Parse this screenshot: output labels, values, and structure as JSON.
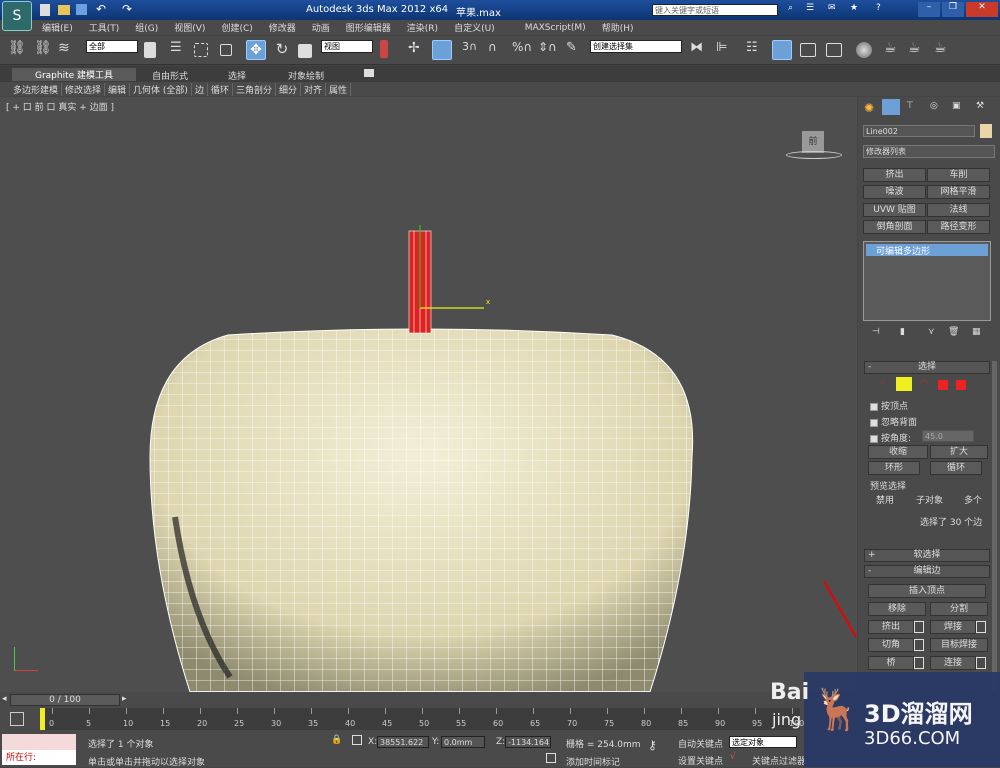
{
  "title": {
    "app": "Autodesk 3ds Max  2012 x64",
    "file": "苹果.max",
    "search_placeholder": "键入关键字或短语"
  },
  "menu": [
    "编辑(E)",
    "工具(T)",
    "组(G)",
    "视图(V)",
    "创建(C)",
    "修改器",
    "动画",
    "图形编辑器",
    "渲染(R)",
    "自定义(U)",
    "MAXScript(M)",
    "帮助(H)"
  ],
  "toolbar": {
    "select_filter": "全部",
    "ref_coord": "视图",
    "named_sel": "创建选择集"
  },
  "ribbon": {
    "tabs": [
      "Graphite 建模工具",
      "自由形式",
      "选择",
      "对象绘制"
    ],
    "items": [
      "多边形建模",
      "修改选择",
      "编辑",
      "几何体 (全部)",
      "边",
      "循环",
      "三角剖分",
      "细分",
      "对齐",
      "属性"
    ]
  },
  "viewport": {
    "label": "[ + 口 前 口 真实 + 边面 ]",
    "cube_label": "前"
  },
  "panel": {
    "object_name": "Line002",
    "modifier_list": "修改器列表",
    "mod_buttons": [
      "挤出",
      "车削",
      "噪波",
      "网格平滑",
      "UVW 贴图",
      "法线",
      "倒角剖面",
      "路径变形"
    ],
    "stack_item": "可编辑多边形",
    "select_title": "选择",
    "by_vertex": "按顶点",
    "ignore_back": "忽略背面",
    "by_angle": "按角度:",
    "angle_value": "45.0",
    "shrink": "收缩",
    "grow": "扩大",
    "ring": "环形",
    "loop": "循环",
    "preview_title": "预览选择",
    "preview_opts": [
      "禁用",
      "子对象",
      "多个"
    ],
    "sel_count": "选择了 30 个边",
    "soft_sel": "软选择",
    "edit_edges": "编辑边",
    "insert_vertex": "插入顶点",
    "remove": "移除",
    "split": "分割",
    "extrude": "挤出",
    "weld": "焊接",
    "chamfer": "切角",
    "target_weld": "目标焊接",
    "bridge": "桥",
    "connect": "连接",
    "plus": "+",
    "minus": "-"
  },
  "timeline": {
    "frame": "0 / 100",
    "ticks": [
      "0",
      "5",
      "10",
      "15",
      "20",
      "25",
      "30",
      "35",
      "40",
      "45",
      "50",
      "55",
      "60",
      "65",
      "70",
      "75",
      "80",
      "85",
      "90",
      "95",
      "100"
    ]
  },
  "status": {
    "location": "所在行:",
    "selected": "选择了 1 个对象",
    "hint": "单击或单击并拖动以选择对象",
    "x_label": "X:",
    "x": "38551.622",
    "y_label": "Y:",
    "y": "0.0mm",
    "z_label": "Z:",
    "z": "-1134.164",
    "grid": "栅格 = 254.0mm",
    "add_time": "添加时间标记",
    "auto_key": "自动关键点",
    "set_key": "设置关键点",
    "sel_obj": "选定对象",
    "key_filter": "关键点过滤器"
  },
  "watermark": {
    "brand": "3D溜溜网",
    "url": "3D66.COM",
    "baidu": "Bai",
    "jing": "jing"
  }
}
